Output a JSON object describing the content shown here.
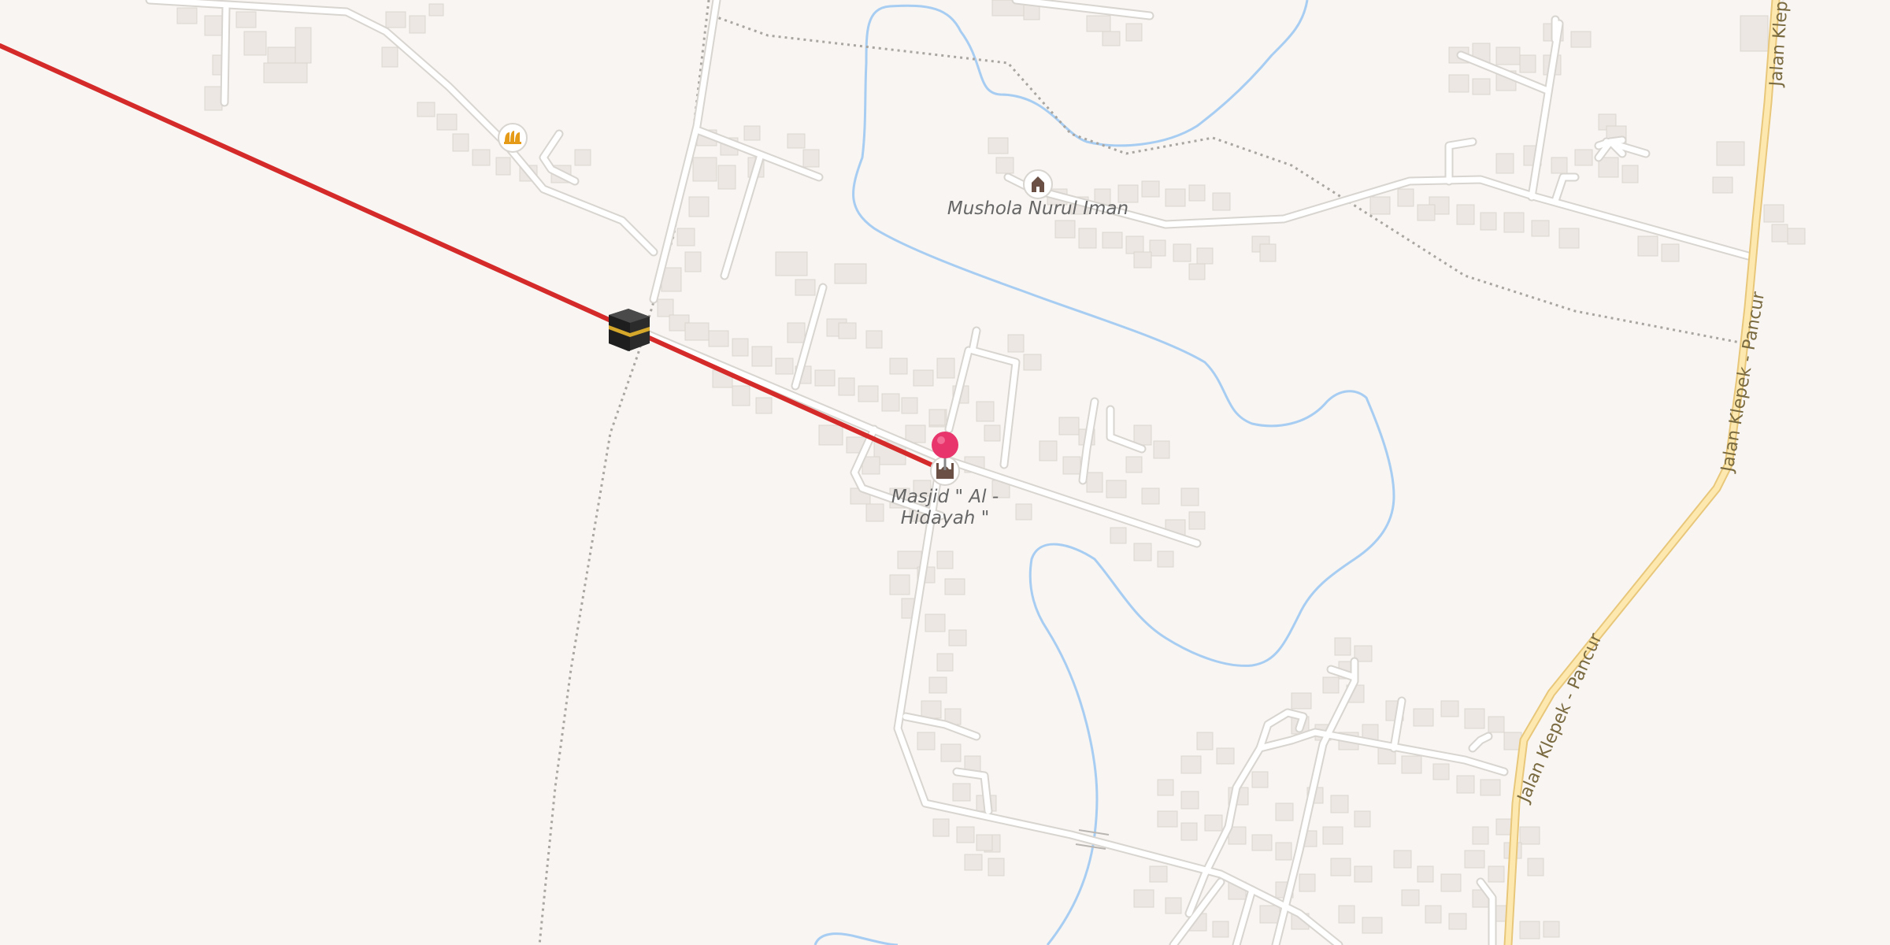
{
  "map": {
    "pois": [
      {
        "id": "masjid",
        "name_line1": "Masjid \" Al -",
        "name_line2": "Hidayah \"",
        "icon": "mosque-icon"
      },
      {
        "id": "mushola",
        "name": "Mushola Nurul Iman",
        "icon": "prayer-house-icon"
      },
      {
        "id": "shop",
        "icon": "bakery-icon"
      }
    ],
    "roads": {
      "primary_name": "Jalan Klepek - Pancur"
    },
    "markers": {
      "kaaba": "kaaba-icon",
      "pin": "location-pin-icon"
    },
    "colors": {
      "background": "#f8f5f2",
      "road": "#ffffff",
      "road_casing": "#d8d4cf",
      "primary_road": "#fde9b0",
      "primary_casing": "#e8c77a",
      "river": "#a7cdf2",
      "building": "#ece7e2",
      "path": "#a9a5a0",
      "qibla_line": "#d42a2a",
      "pin": "#e8356b"
    }
  }
}
